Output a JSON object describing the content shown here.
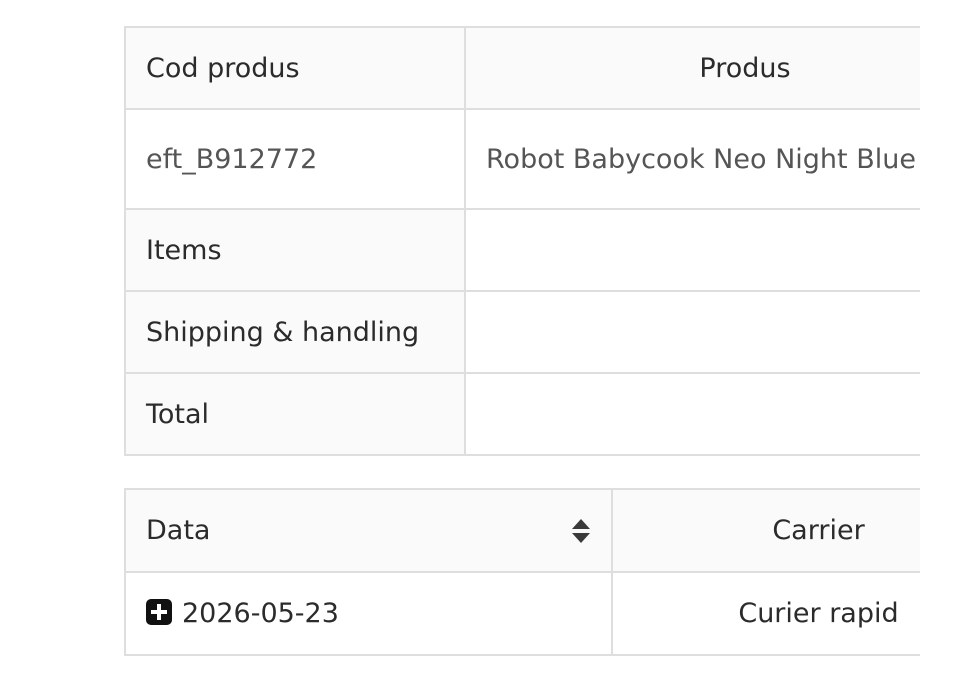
{
  "products_table": {
    "headers": {
      "code": "Cod produs",
      "product": "Produs"
    },
    "rows": [
      {
        "code": "eft_B912772",
        "product": "Robot Babycook Neo Night Blue"
      }
    ],
    "summary": [
      {
        "label": "Items"
      },
      {
        "label": "Shipping & handling"
      },
      {
        "label": "Total"
      }
    ]
  },
  "shipping_table": {
    "headers": {
      "date": "Data",
      "carrier": "Carrier"
    },
    "rows": [
      {
        "date": "2026-05-23",
        "carrier": "Curier rapid"
      }
    ]
  },
  "icons": {
    "sort": "sort-icon",
    "expand": "plus-square-icon"
  },
  "colors": {
    "border": "#dedede",
    "header_bg": "#fafafa",
    "text": "#2b2b2b",
    "muted_text": "#555555"
  }
}
